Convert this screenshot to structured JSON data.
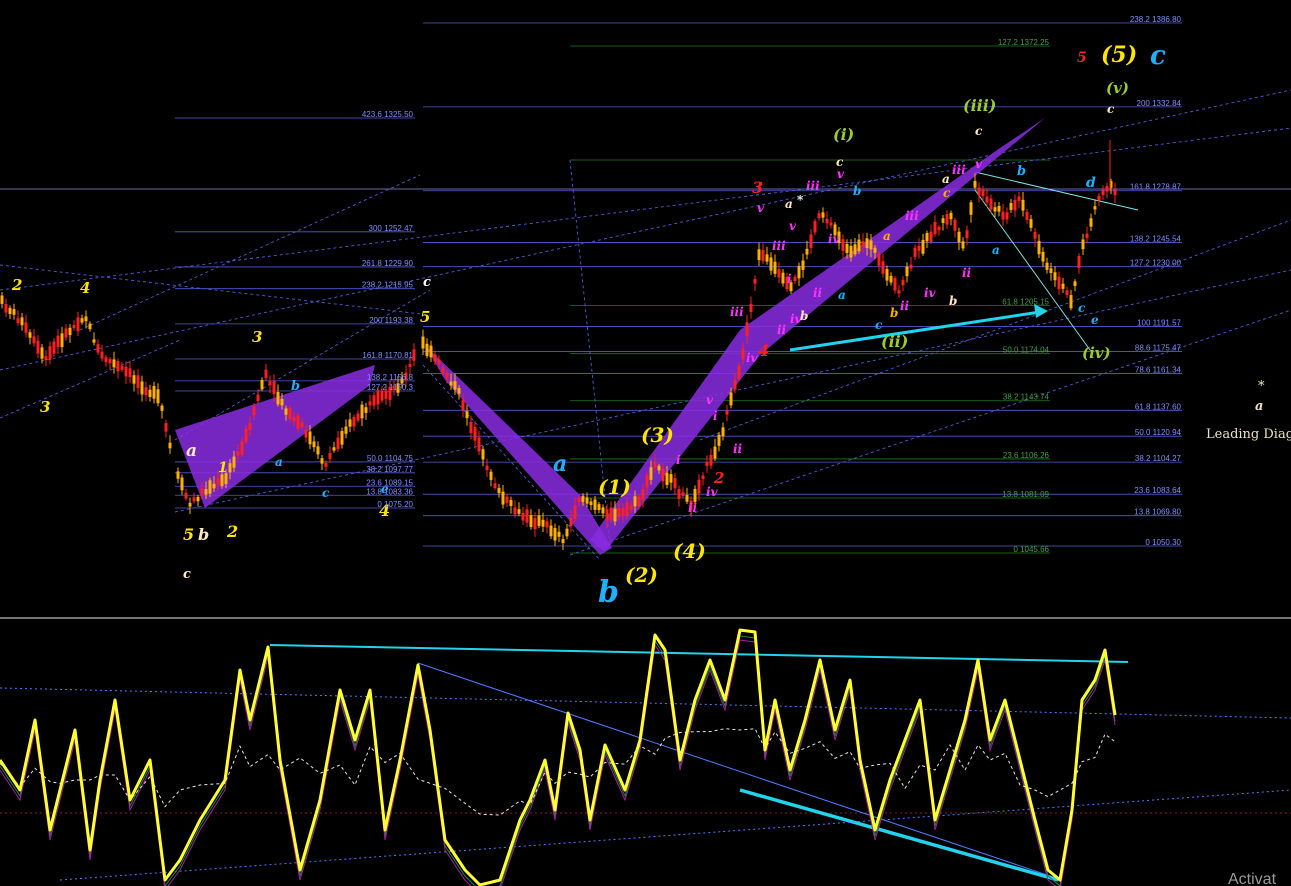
{
  "chart_data": {
    "type": "candlestick",
    "fib_levels_left": [
      {
        "ratio": "423.6",
        "price": "1325.50"
      },
      {
        "ratio": "300",
        "price": "1252.47"
      },
      {
        "ratio": "261.8",
        "price": "1229.90"
      },
      {
        "ratio": "238.2",
        "price": "1215.95"
      },
      {
        "ratio": "200",
        "price": "1193.38"
      },
      {
        "ratio": "161.8",
        "price": "1170.81"
      },
      {
        "ratio": "138.2",
        "price": "1156.8"
      },
      {
        "ratio": "127.2",
        "price": "1150.3"
      },
      {
        "ratio": "50.0",
        "price": "1104.75"
      },
      {
        "ratio": "38.2",
        "price": "1097.77"
      },
      {
        "ratio": "23.6",
        "price": "1089.15"
      },
      {
        "ratio": "13.8",
        "price": "1083.36"
      },
      {
        "ratio": "0",
        "price": "1075.20"
      }
    ],
    "fib_levels_right": [
      {
        "ratio": "238.2",
        "price": "1386.80"
      },
      {
        "ratio": "200",
        "price": "1332.84"
      },
      {
        "ratio": "161.8",
        "price": "1278.87"
      },
      {
        "ratio": "138.2",
        "price": "1245.54"
      },
      {
        "ratio": "127.2",
        "price": "1230.00"
      },
      {
        "ratio": "100",
        "price": "1191.57"
      },
      {
        "ratio": "88.6",
        "price": "1175.47"
      },
      {
        "ratio": "78.6",
        "price": "1161.34"
      },
      {
        "ratio": "61.8",
        "price": "1137.60"
      },
      {
        "ratio": "50.0",
        "price": "1120.94"
      },
      {
        "ratio": "38.2",
        "price": "1104.27"
      },
      {
        "ratio": "23.6",
        "price": "1083.64"
      },
      {
        "ratio": "13.8",
        "price": "1069.80"
      },
      {
        "ratio": "0",
        "price": "1050.30"
      }
    ],
    "fib_levels_green": [
      {
        "ratio": "127.2",
        "price": "1372.25"
      },
      {
        "ratio": "61.8",
        "price": "1205.15"
      },
      {
        "ratio": "50.0",
        "price": "1174.04"
      },
      {
        "ratio": "38.2",
        "price": "1143.74"
      },
      {
        "ratio": "23.6",
        "price": "1106.26"
      },
      {
        "ratio": "13.8",
        "price": "1081.09"
      },
      {
        "ratio": "0",
        "price": "1045.66"
      }
    ],
    "wave_labels": [
      "2",
      "4",
      "3",
      "5",
      "b",
      "2",
      "a",
      "1",
      "3",
      "b",
      "a",
      "c",
      "e",
      "4",
      "5",
      "c",
      "c",
      "a",
      "b",
      "(1)",
      "(2)",
      "(3)",
      "(4)",
      "3",
      "4",
      "2",
      "(i)",
      "(ii)",
      "(iii)",
      "(iv)",
      "(v)",
      "a",
      "b",
      "c",
      "d",
      "e",
      "5",
      "(5)",
      "c"
    ],
    "side_labels": {
      "asterisk": "*",
      "letter": "a",
      "text": "Leading Diag"
    },
    "watermark": "Activat",
    "colors": {
      "background": "#000000",
      "bull_candle": "#ffb000",
      "bear_candle": "#ff2020",
      "fib_blue": "#4f5bd6",
      "fib_green": "#1e7a1e",
      "channel": "#8a2be2",
      "oscillator": "#ffff33",
      "trend_cyan": "#22d3ee",
      "wave_yellow": "#ffe600",
      "wave_cyan": "#1fb0ff",
      "wave_red": "#ff2020",
      "wave_magenta": "#ff33ff",
      "wave_olive": "#9acd32"
    }
  }
}
